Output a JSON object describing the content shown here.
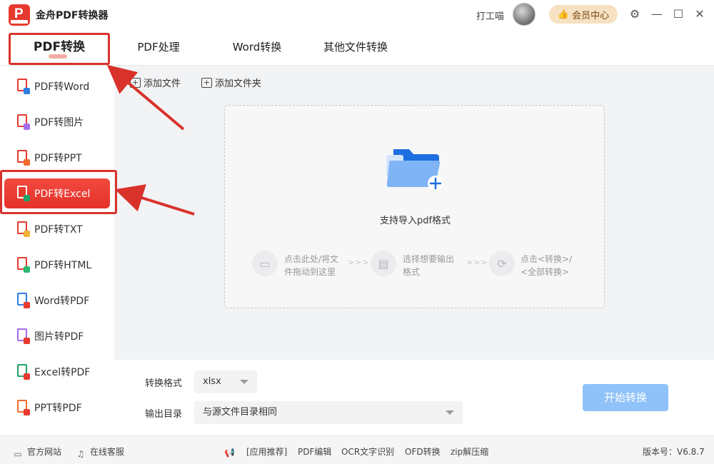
{
  "app": {
    "title": "金舟PDF转换器",
    "user_name": "打工喵",
    "vip_label": "会员中心",
    "window_controls": [
      "settings-icon",
      "minimize-icon",
      "maximize-icon",
      "close-icon"
    ]
  },
  "tabs": [
    {
      "label": "PDF转换",
      "active": true
    },
    {
      "label": "PDF处理",
      "active": false
    },
    {
      "label": "Word转换",
      "active": false
    },
    {
      "label": "其他文件转换",
      "active": false
    }
  ],
  "sidebar": {
    "items": [
      {
        "label": "PDF转Word",
        "icon": "pdf-to-word-icon"
      },
      {
        "label": "PDF转图片",
        "icon": "pdf-to-image-icon"
      },
      {
        "label": "PDF转PPT",
        "icon": "pdf-to-ppt-icon"
      },
      {
        "label": "PDF转Excel",
        "icon": "pdf-to-excel-icon",
        "active": true
      },
      {
        "label": "PDF转TXT",
        "icon": "pdf-to-txt-icon"
      },
      {
        "label": "PDF转HTML",
        "icon": "pdf-to-html-icon"
      },
      {
        "label": "Word转PDF",
        "icon": "word-to-pdf-icon"
      },
      {
        "label": "图片转PDF",
        "icon": "image-to-pdf-icon"
      },
      {
        "label": "Excel转PDF",
        "icon": "excel-to-pdf-icon"
      },
      {
        "label": "PPT转PDF",
        "icon": "ppt-to-pdf-icon"
      }
    ]
  },
  "toolbar": {
    "add_file": "添加文件",
    "add_folder": "添加文件夹"
  },
  "dropzone": {
    "title": "支持导入pdf格式",
    "steps": [
      {
        "line1": "点击此处/将文",
        "line2": "件拖动到这里"
      },
      {
        "line1": "选择想要输出",
        "line2": "格式"
      },
      {
        "line1": "点击<转换>/",
        "line2": "<全部转换>"
      }
    ],
    "step_arrow": ">>>"
  },
  "settings": {
    "format_label": "转换格式",
    "format_value": "xlsx",
    "output_label": "输出目录",
    "output_value": "与源文件目录相同",
    "start_button": "开始转换"
  },
  "footer": {
    "official_site": "官方网站",
    "online_service": "在线客服",
    "recommend": "[应用推荐]",
    "links": [
      "PDF编辑",
      "OCR文字识别",
      "OFD转换",
      "zip解压缩"
    ],
    "version": "版本号：V6.8.7"
  },
  "colors": {
    "accent_red": "#e8392f",
    "start_button": "#8ec2f8",
    "vip_bg": "#f6e1c2",
    "annotation_red": "#d9322b"
  }
}
